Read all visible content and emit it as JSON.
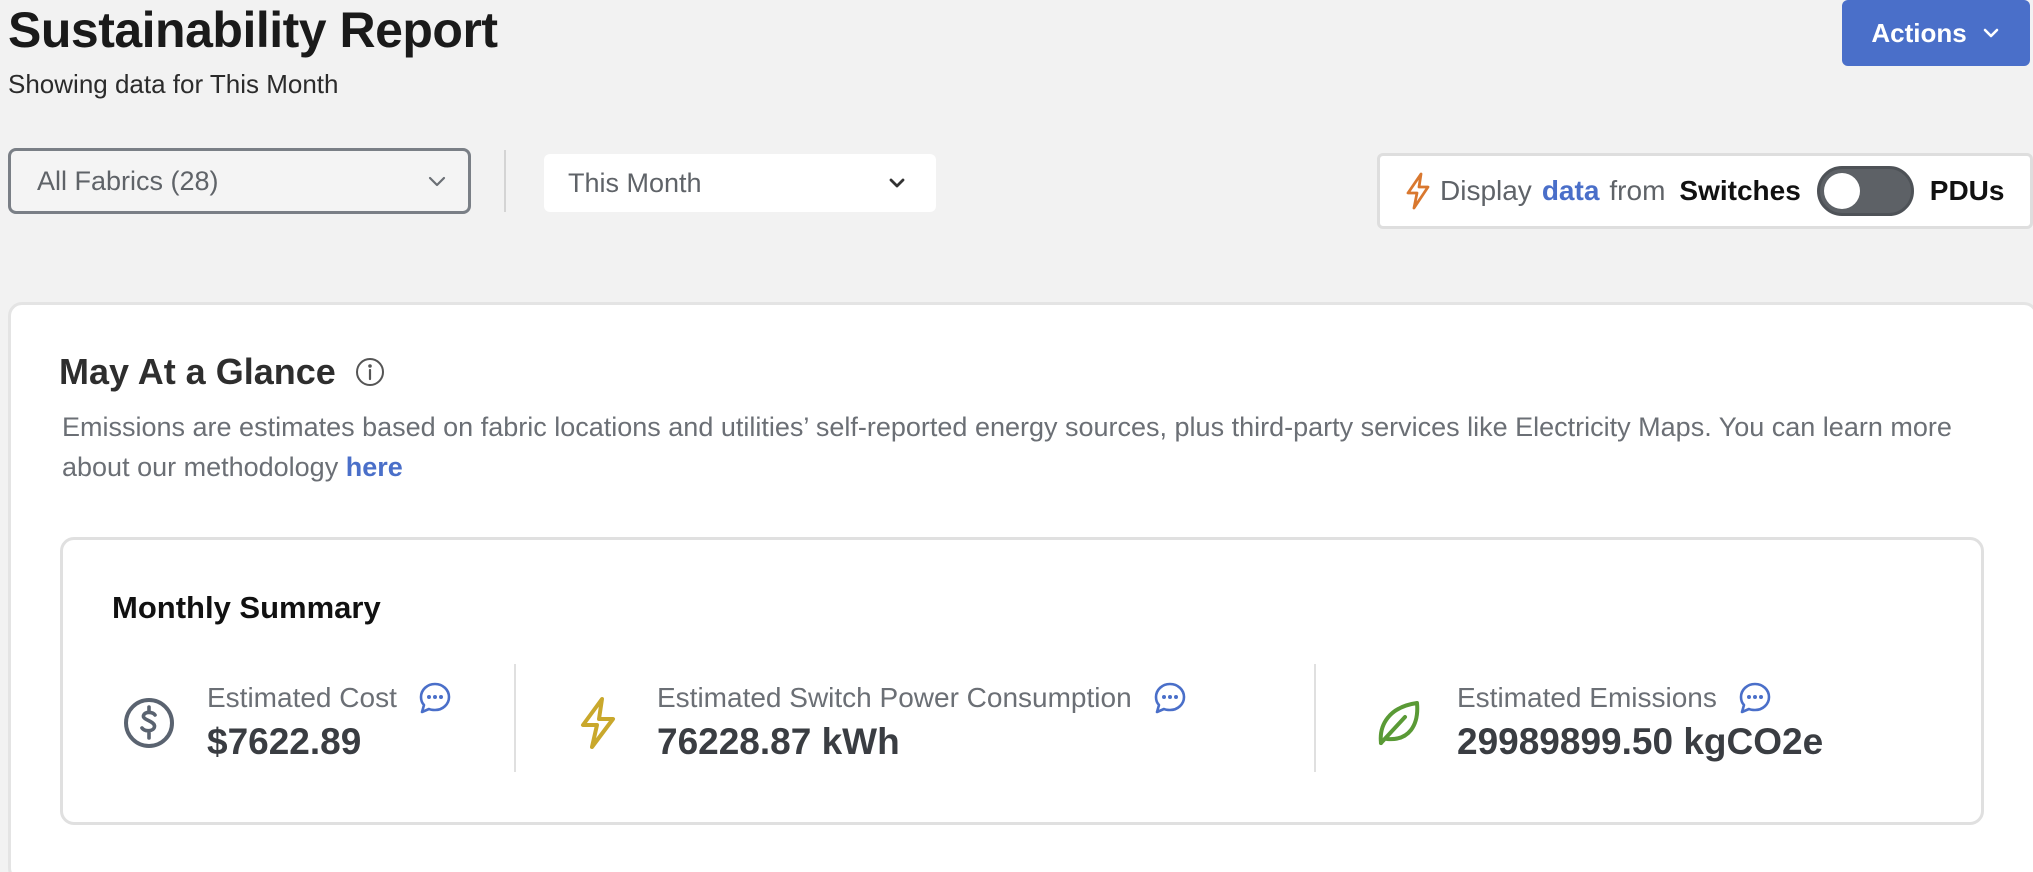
{
  "header": {
    "title": "Sustainability Report",
    "subtitle": "Showing data for This Month",
    "actions_label": "Actions"
  },
  "filters": {
    "fabric_value": "All Fabrics (28)",
    "period_value": "This Month"
  },
  "display_toggle": {
    "prefix": "Display",
    "highlight": "data",
    "from_word": "from",
    "left_option": "Switches",
    "right_option": "PDUs",
    "state": "Switches"
  },
  "glance": {
    "title": "May At a Glance",
    "description": "Emissions are estimates based on fabric locations and utilities’ self-reported energy sources, plus third-party services like Electricity Maps. You can learn more about our methodology",
    "link_label": "here"
  },
  "summary": {
    "title": "Monthly Summary",
    "metrics": [
      {
        "label": "Estimated Cost",
        "value": "$7622.89",
        "icon": "dollar-circle-icon",
        "color": "#5a6370"
      },
      {
        "label": "Estimated Switch Power Consumption",
        "value": "76228.87 kWh",
        "icon": "lightning-bolt-icon",
        "color": "#c9a82c"
      },
      {
        "label": "Estimated Emissions",
        "value": "29989899.50 kgCO2e",
        "icon": "leaf-icon",
        "color": "#5a9a36"
      }
    ]
  },
  "colors": {
    "accent": "#4a6fc9",
    "bolt_orange": "#d9782f",
    "background": "#f2f2f2"
  }
}
